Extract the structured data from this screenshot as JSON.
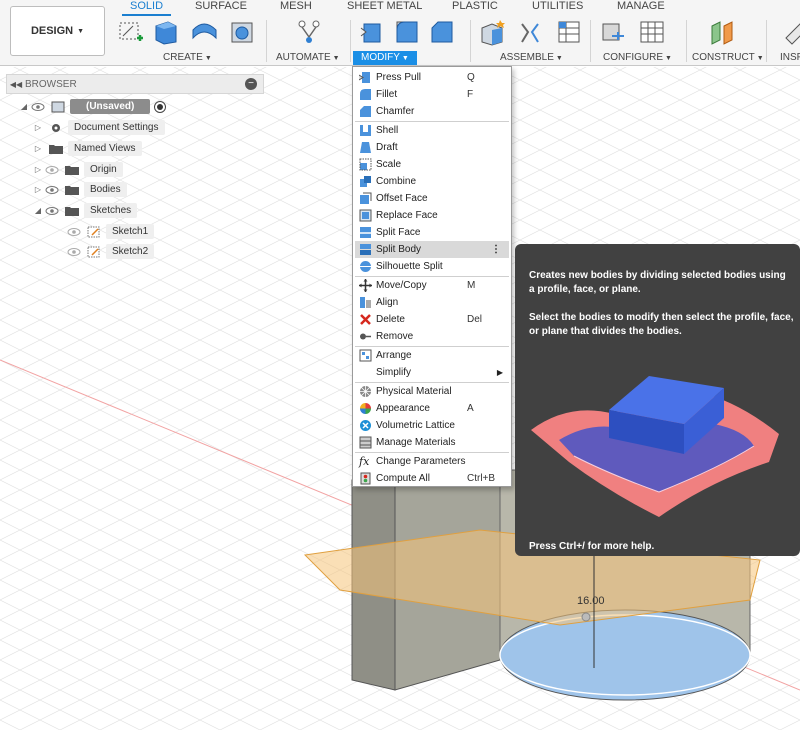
{
  "toolbar": {
    "workspace_label": "DESIGN",
    "tabs": [
      "SOLID",
      "SURFACE",
      "MESH",
      "SHEET METAL",
      "PLASTIC",
      "UTILITIES",
      "MANAGE"
    ],
    "groups": [
      "CREATE",
      "AUTOMATE",
      "MODIFY",
      "ASSEMBLE",
      "CONFIGURE",
      "CONSTRUCT",
      "INSP"
    ]
  },
  "browser": {
    "title": "BROWSER",
    "root": "(Unsaved)",
    "items": [
      "Document Settings",
      "Named Views",
      "Origin",
      "Bodies",
      "Sketches"
    ],
    "sketches": [
      "Sketch1",
      "Sketch2"
    ]
  },
  "menu": {
    "items": [
      {
        "label": "Press Pull",
        "shortcut": "Q"
      },
      {
        "label": "Fillet",
        "shortcut": "F"
      },
      {
        "label": "Chamfer",
        "shortcut": ""
      },
      {
        "label": "Shell",
        "shortcut": ""
      },
      {
        "label": "Draft",
        "shortcut": ""
      },
      {
        "label": "Scale",
        "shortcut": ""
      },
      {
        "label": "Combine",
        "shortcut": ""
      },
      {
        "label": "Offset Face",
        "shortcut": ""
      },
      {
        "label": "Replace Face",
        "shortcut": ""
      },
      {
        "label": "Split Face",
        "shortcut": ""
      },
      {
        "label": "Split Body",
        "shortcut": ""
      },
      {
        "label": "Silhouette Split",
        "shortcut": ""
      },
      {
        "label": "Move/Copy",
        "shortcut": "M"
      },
      {
        "label": "Align",
        "shortcut": ""
      },
      {
        "label": "Delete",
        "shortcut": "Del"
      },
      {
        "label": "Remove",
        "shortcut": ""
      },
      {
        "label": "Arrange",
        "shortcut": ""
      },
      {
        "label": "Simplify",
        "shortcut": ""
      },
      {
        "label": "Physical Material",
        "shortcut": ""
      },
      {
        "label": "Appearance",
        "shortcut": "A"
      },
      {
        "label": "Volumetric Lattice",
        "shortcut": ""
      },
      {
        "label": "Manage Materials",
        "shortcut": ""
      },
      {
        "label": "Change Parameters",
        "shortcut": ""
      },
      {
        "label": "Compute All",
        "shortcut": "Ctrl+B"
      }
    ],
    "highlighted": "Split Body"
  },
  "tooltip": {
    "line1": "Creates new bodies by dividing selected bodies using a profile, face, or plane.",
    "line2": "Select the bodies to modify then select the profile, face, or plane that divides the bodies.",
    "footer": "Press Ctrl+/ for more help."
  },
  "viewport": {
    "dimension": "16.00"
  },
  "colors": {
    "accent": "#1b8fe6",
    "tooltip_bg": "#414141",
    "plane": "#f5c57a",
    "body": "#9a9a8c"
  }
}
